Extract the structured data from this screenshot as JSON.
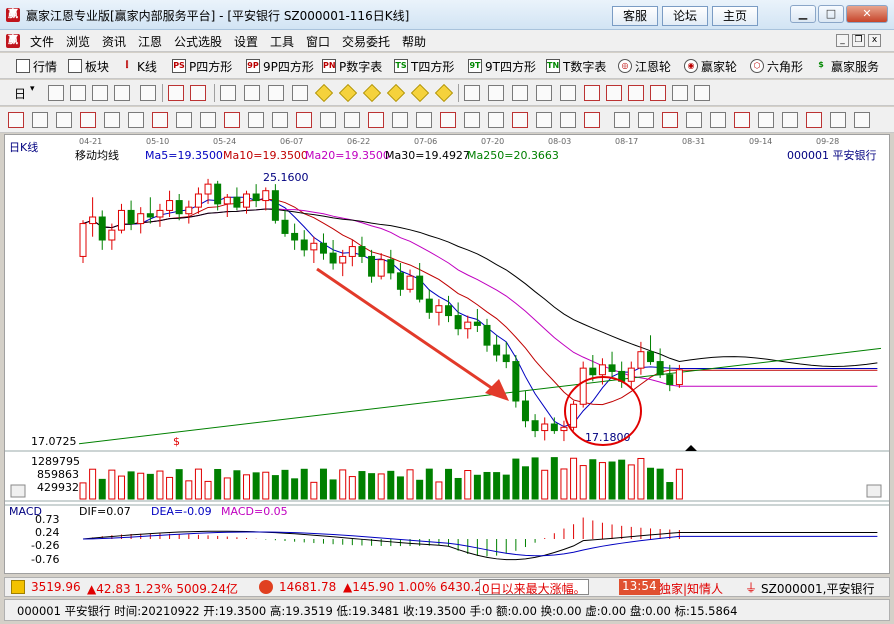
{
  "window": {
    "title": "赢家江恩专业版[赢家内部服务平台] - [平安银行  SZ000001-116日K线]",
    "buttons": [
      "客服",
      "论坛",
      "主页"
    ]
  },
  "menu": [
    "文件",
    "浏览",
    "资讯",
    "江恩",
    "公式选股",
    "设置",
    "工具",
    "窗口",
    "交易委托",
    "帮助"
  ],
  "toolbar_main": [
    "行情",
    "板块",
    "K线",
    "P四方形",
    "9P四方形",
    "P数字表",
    "T四方形",
    "9T四方形",
    "T数字表",
    "江恩轮",
    "赢家轮",
    "六角形",
    "赢家服务"
  ],
  "toolbar_period_label": "日",
  "chart": {
    "period_label": "日K线",
    "indicator_name": "移动均线",
    "ma_labels": [
      {
        "text": "Ma5=19.3500",
        "color": "#0000c0"
      },
      {
        "text": "Ma10=19.3500",
        "color": "#c00000"
      },
      {
        "text": "Ma20=19.3500",
        "color": "#c000c0"
      },
      {
        "text": "Ma30=19.4927",
        "color": "#000000"
      },
      {
        "text": "Ma250=20.3663",
        "color": "#008000"
      }
    ],
    "stock": "000001  平安银行",
    "date_ticks": [
      "04-21",
      "05-10",
      "05-24",
      "06-07",
      "06-22",
      "07-06",
      "07-20",
      "08-03",
      "08-17",
      "08-31",
      "09-14",
      "09-28"
    ],
    "price_low_label": "17.0725",
    "high_annotation": "25.1600",
    "low_annotation": "17.1800",
    "volume_labels": [
      "1289795",
      "859863",
      "429932"
    ],
    "macd_name": "MACD",
    "macd_values": [
      {
        "text": "DIF=0.07",
        "color": "#000000"
      },
      {
        "text": "DEA=-0.09",
        "color": "#0000c0"
      },
      {
        "text": "MACD=0.05",
        "color": "#c000c0"
      }
    ],
    "macd_axis": [
      "0.73",
      "0.24",
      "-0.26",
      "-0.76"
    ],
    "accent_up": "#e00000",
    "accent_down": "#008000"
  },
  "status1": {
    "idx1": "3519.96",
    "idx1_chg": "▲42.83 1.23% 5009.24亿",
    "idx2": "14681.78",
    "idx2_chg": "▲145.90 1.00% 6430.29",
    "ticker_text": "0日以来最大涨幅。",
    "time": "13:54",
    "news": "独家|知情人",
    "stock": "SZ000001,平安银行"
  },
  "status2": {
    "text": "000001 平安银行 时间:20210922 开:19.3500 高:19.3519 低:19.3481 收:19.3500 手:0 额:0.00 换:0.00 虚:0.00 盘:0.00 标:15.5864"
  },
  "chart_data": {
    "type": "candlestick",
    "x_ticks": [
      "04-21",
      "05-10",
      "05-24",
      "06-07",
      "06-22",
      "07-06",
      "07-20",
      "08-03",
      "08-17",
      "08-31",
      "09-14",
      "09-28"
    ],
    "high_label": 25.16,
    "low_label": 17.18,
    "price_axis_min": 17.0725,
    "ma_values": {
      "Ma5": 19.35,
      "Ma10": 19.35,
      "Ma20": 19.35,
      "Ma30": 19.4927,
      "Ma250": 20.3663
    },
    "volume_ticks": [
      1289795,
      859863,
      429932
    ],
    "macd_ticks": [
      0.73,
      0.24,
      -0.26,
      -0.76
    ],
    "macd_current": {
      "DIF": 0.07,
      "DEA": -0.09,
      "MACD": 0.05
    },
    "candles": [
      [
        22.8,
        23.9,
        22.6,
        23.8
      ],
      [
        23.8,
        24.6,
        23.4,
        24.0
      ],
      [
        24.0,
        24.2,
        23.0,
        23.3
      ],
      [
        23.3,
        23.8,
        23.0,
        23.6
      ],
      [
        23.6,
        24.4,
        23.5,
        24.2
      ],
      [
        24.2,
        24.5,
        23.6,
        23.8
      ],
      [
        23.8,
        24.3,
        23.5,
        24.1
      ],
      [
        24.1,
        24.6,
        23.8,
        24.0
      ],
      [
        24.0,
        24.4,
        23.7,
        24.2
      ],
      [
        24.2,
        24.8,
        24.0,
        24.5
      ],
      [
        24.5,
        24.7,
        23.9,
        24.1
      ],
      [
        24.1,
        24.5,
        23.8,
        24.3
      ],
      [
        24.3,
        24.9,
        24.1,
        24.7
      ],
      [
        24.7,
        25.16,
        24.4,
        25.0
      ],
      [
        25.0,
        25.1,
        24.2,
        24.4
      ],
      [
        24.4,
        24.7,
        24.0,
        24.6
      ],
      [
        24.6,
        24.9,
        24.2,
        24.3
      ],
      [
        24.3,
        24.8,
        24.1,
        24.7
      ],
      [
        24.7,
        25.0,
        24.3,
        24.5
      ],
      [
        24.5,
        24.9,
        24.2,
        24.8
      ],
      [
        24.8,
        25.0,
        23.8,
        23.9
      ],
      [
        23.9,
        24.2,
        23.4,
        23.5
      ],
      [
        23.5,
        23.8,
        23.0,
        23.3
      ],
      [
        23.3,
        23.6,
        22.8,
        23.0
      ],
      [
        23.0,
        23.4,
        22.6,
        23.2
      ],
      [
        23.2,
        23.5,
        22.7,
        22.9
      ],
      [
        22.9,
        23.3,
        22.4,
        22.6
      ],
      [
        22.6,
        23.0,
        22.2,
        22.8
      ],
      [
        22.8,
        23.3,
        22.5,
        23.1
      ],
      [
        23.1,
        23.4,
        22.6,
        22.8
      ],
      [
        22.8,
        23.0,
        22.0,
        22.2
      ],
      [
        22.2,
        22.9,
        22.1,
        22.7
      ],
      [
        22.7,
        23.0,
        22.1,
        22.3
      ],
      [
        22.3,
        22.6,
        21.6,
        21.8
      ],
      [
        21.8,
        22.4,
        21.7,
        22.2
      ],
      [
        22.2,
        22.6,
        21.4,
        21.5
      ],
      [
        21.5,
        21.8,
        20.9,
        21.1
      ],
      [
        21.1,
        21.5,
        20.7,
        21.3
      ],
      [
        21.3,
        21.6,
        20.8,
        21.0
      ],
      [
        21.0,
        21.4,
        20.4,
        20.6
      ],
      [
        20.6,
        21.0,
        20.3,
        20.8
      ],
      [
        20.8,
        21.2,
        20.5,
        20.7
      ],
      [
        20.7,
        20.9,
        19.9,
        20.1
      ],
      [
        20.1,
        20.4,
        19.6,
        19.8
      ],
      [
        19.8,
        20.2,
        19.4,
        19.6
      ],
      [
        19.6,
        19.8,
        18.2,
        18.4
      ],
      [
        18.4,
        18.7,
        17.6,
        17.8
      ],
      [
        17.8,
        18.0,
        17.3,
        17.5
      ],
      [
        17.5,
        17.9,
        17.2,
        17.7
      ],
      [
        17.7,
        17.9,
        17.4,
        17.5
      ],
      [
        17.5,
        17.8,
        17.18,
        17.6
      ],
      [
        17.6,
        18.4,
        17.5,
        18.3
      ],
      [
        18.3,
        19.6,
        18.2,
        19.4
      ],
      [
        19.4,
        19.8,
        19.0,
        19.2
      ],
      [
        19.2,
        19.7,
        18.9,
        19.5
      ],
      [
        19.5,
        19.9,
        19.1,
        19.3
      ],
      [
        19.3,
        19.6,
        18.8,
        19.0
      ],
      [
        19.0,
        19.6,
        18.8,
        19.4
      ],
      [
        19.4,
        20.2,
        19.2,
        19.9
      ],
      [
        19.9,
        20.4,
        19.5,
        19.6
      ],
      [
        19.6,
        20.0,
        19.1,
        19.2
      ],
      [
        19.2,
        19.5,
        18.7,
        18.9
      ],
      [
        18.9,
        19.5,
        18.8,
        19.35
      ]
    ]
  }
}
